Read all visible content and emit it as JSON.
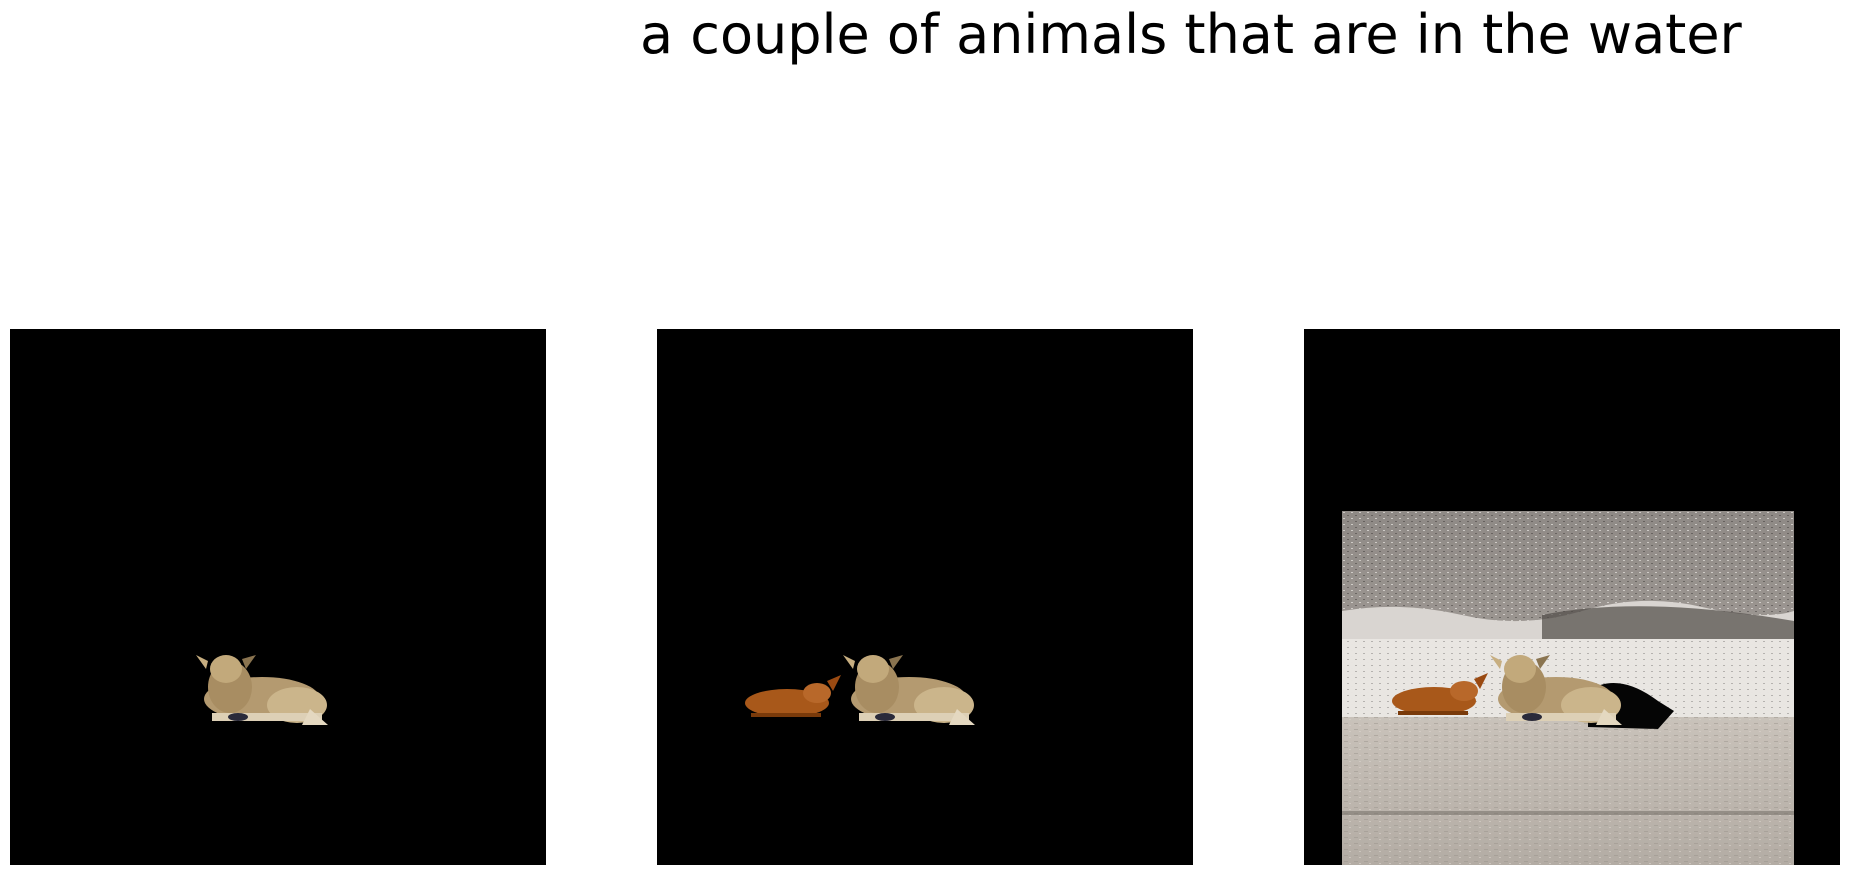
{
  "caption": "a couple of animals that are in the water",
  "panels": [
    {
      "id": "panel-1",
      "content": "single cow cutout on black background"
    },
    {
      "id": "panel-2",
      "content": "two cows cutout on black background"
    },
    {
      "id": "panel-3",
      "content": "two cows on beach with waves, partial scene on black background"
    }
  ],
  "colors": {
    "background": "#000000",
    "page": "#ffffff",
    "text": "#000000",
    "cow_tan": "#b49a70",
    "cow_brown": "#a8581a",
    "sand": "#bdb6ae",
    "water": "#8a8480"
  }
}
